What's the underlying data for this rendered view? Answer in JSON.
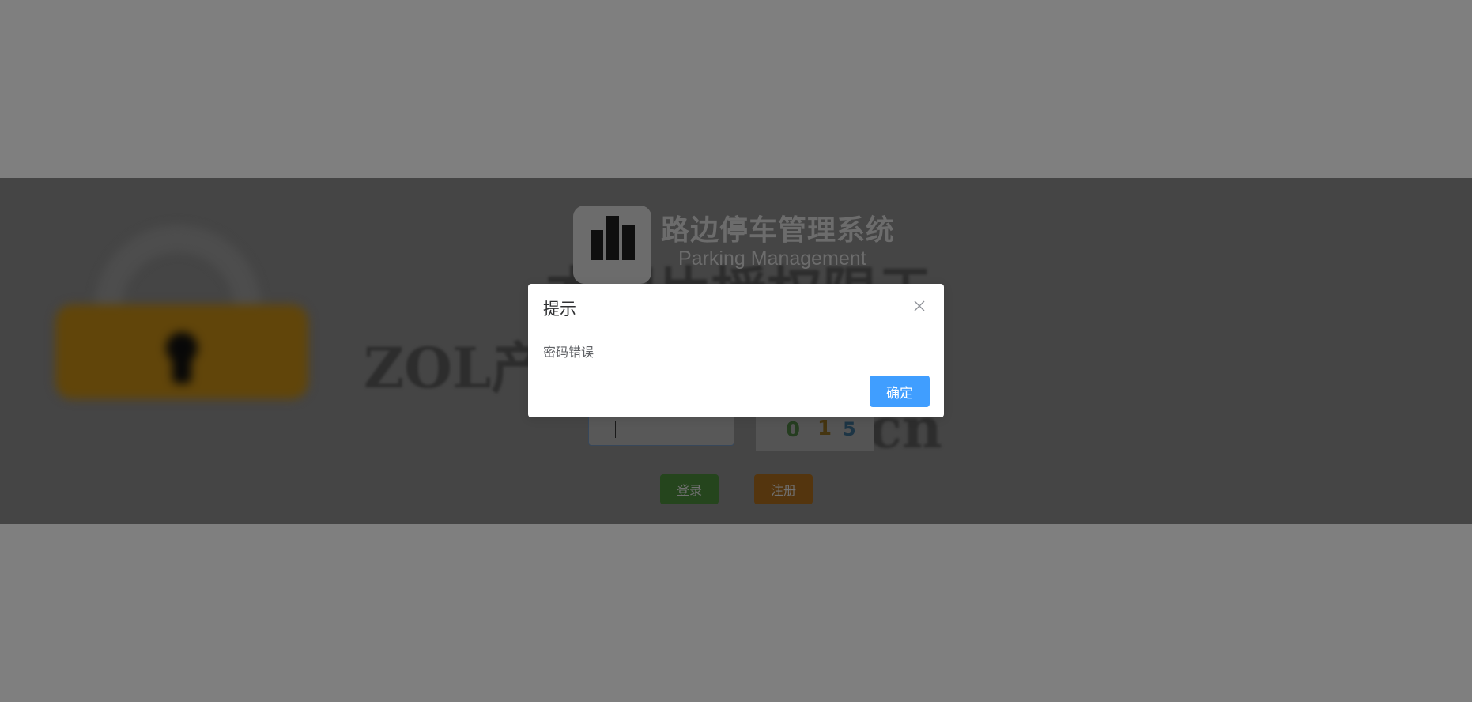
{
  "app": {
    "title_cn": "路边停车管理系统",
    "title_en": "Parking Management",
    "logo_icon": "bar-chart-icon"
  },
  "background_watermark": {
    "line1": "本图片授权限于",
    "line2": "ZOL产品沟通使用！",
    "line3": "m.cn"
  },
  "form": {
    "captcha_digits": [
      "0",
      "1",
      "5"
    ]
  },
  "buttons": {
    "login": "登录",
    "register": "注册"
  },
  "dialog": {
    "title": "提示",
    "message": "密码错误",
    "confirm": "确定",
    "close_icon": "close-icon"
  },
  "colors": {
    "primary": "#409eff",
    "login": "#67c23a",
    "register": "#e6a23c"
  }
}
